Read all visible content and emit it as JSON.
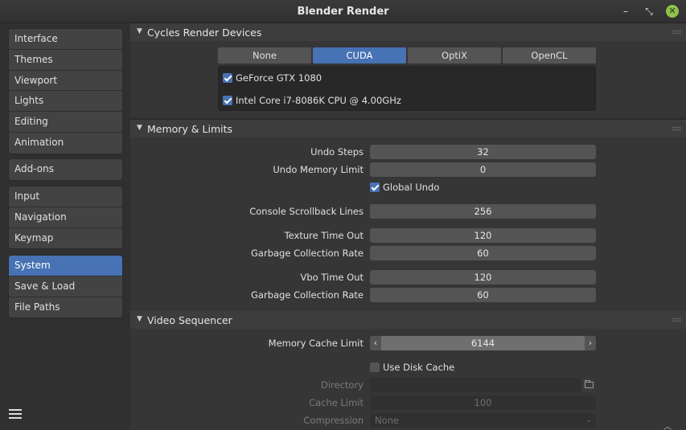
{
  "window": {
    "title": "Blender Render"
  },
  "window_controls": {
    "minimize": "–",
    "maximize": "⤡",
    "close": "✕"
  },
  "sidebar": {
    "groups": [
      [
        "Interface",
        "Themes",
        "Viewport",
        "Lights",
        "Editing",
        "Animation"
      ],
      [
        "Add-ons"
      ],
      [
        "Input",
        "Navigation",
        "Keymap"
      ],
      [
        "System",
        "Save & Load",
        "File Paths"
      ]
    ],
    "active": "System"
  },
  "cycles": {
    "title": "Cycles Render Devices",
    "tabs": [
      "None",
      "CUDA",
      "OptiX",
      "OpenCL"
    ],
    "active_tab": "CUDA",
    "devices": [
      {
        "name": "GeForce GTX 1080",
        "checked": true
      },
      {
        "name": "Intel Core i7-8086K CPU @ 4.00GHz",
        "checked": true
      }
    ]
  },
  "memory": {
    "title": "Memory & Limits",
    "undo_steps_label": "Undo Steps",
    "undo_steps": "32",
    "undo_memory_label": "Undo Memory Limit",
    "undo_memory": "0",
    "global_undo_label": "Global Undo",
    "global_undo": true,
    "console_label": "Console Scrollback Lines",
    "console": "256",
    "texture_timeout_label": "Texture Time Out",
    "texture_timeout": "120",
    "gc_rate_label": "Garbage Collection Rate",
    "gc_rate": "60",
    "vbo_timeout_label": "Vbo Time Out",
    "vbo_timeout": "120",
    "vbo_gc_rate_label": "Garbage Collection Rate",
    "vbo_gc_rate": "60"
  },
  "sequencer": {
    "title": "Video Sequencer",
    "memory_cache_label": "Memory Cache Limit",
    "memory_cache": "6144",
    "use_disk_cache_label": "Use Disk Cache",
    "use_disk_cache": false,
    "directory_label": "Directory",
    "directory": "",
    "cache_limit_label": "Cache Limit",
    "cache_limit": "100",
    "compression_label": "Compression",
    "compression": "None"
  },
  "icons": {
    "arrow_left": "‹",
    "arrow_right": "›",
    "panel_expanded": "▼",
    "dropdown": "⌄",
    "scroll_up": "︿"
  },
  "colors": {
    "accent": "#4772b3",
    "panel_header": "#3d3d3d",
    "field": "#545454",
    "close_button": "#8cc34a"
  }
}
